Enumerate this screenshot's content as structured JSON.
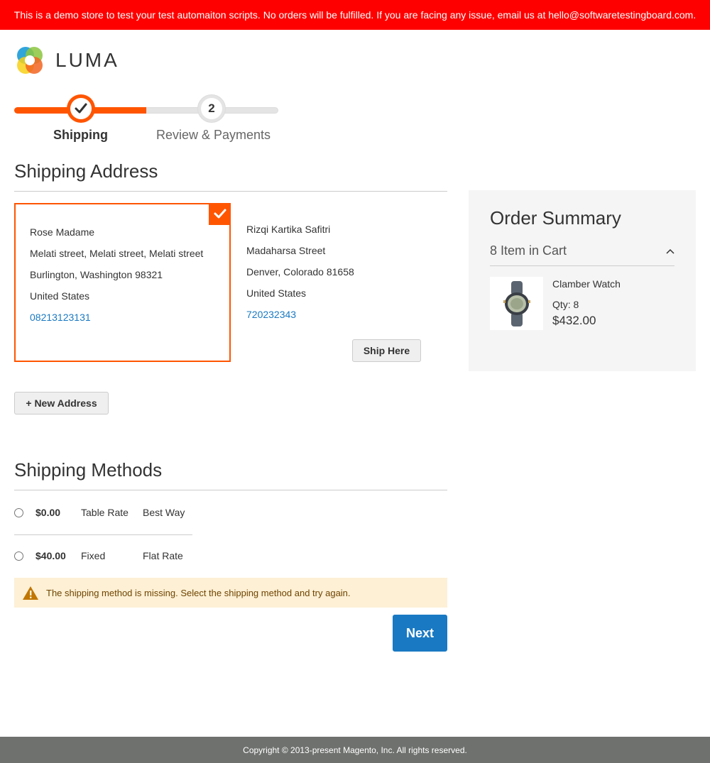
{
  "banner": {
    "text": "This is a demo store to test your test automaiton scripts. No orders will be fulfilled. If you are facing any issue, email us at hello@softwaretestingboard.com."
  },
  "logo": {
    "text": "LUMA"
  },
  "progress": {
    "steps": [
      {
        "label": "Shipping",
        "state": "complete"
      },
      {
        "label": "Review & Payments",
        "number": "2",
        "state": "pending"
      }
    ]
  },
  "shipping_address": {
    "title": "Shipping Address",
    "addresses": [
      {
        "name": "Rose Madame",
        "street": "Melati street, Melati street, Melati street",
        "city_line": "Burlington, Washington 98321",
        "country": "United States",
        "phone": "08213123131",
        "selected": true
      },
      {
        "name": "Rizqi Kartika Safitri",
        "street": "Madaharsa Street",
        "city_line": "Denver, Colorado 81658",
        "country": "United States",
        "phone": "720232343",
        "selected": false
      }
    ],
    "ship_here_label": "Ship Here",
    "new_address_label": "+ New Address"
  },
  "shipping_methods": {
    "title": "Shipping Methods",
    "methods": [
      {
        "price": "$0.00",
        "method": "Table Rate",
        "carrier": "Best Way"
      },
      {
        "price": "$40.00",
        "method": "Fixed",
        "carrier": "Flat Rate"
      }
    ],
    "error": "The shipping method is missing. Select the shipping method and try again.",
    "next_label": "Next"
  },
  "order_summary": {
    "title": "Order Summary",
    "cart_count_label": "8 Item in Cart",
    "items": [
      {
        "name": "Clamber Watch",
        "qty_label": "Qty: 8",
        "price": "$432.00"
      }
    ]
  },
  "footer": {
    "text": "Copyright © 2013-present Magento, Inc. All rights reserved."
  },
  "colors": {
    "accent": "#ff5501",
    "link": "#1979c3",
    "banner": "#ff0000",
    "button_primary": "#1979c3"
  }
}
